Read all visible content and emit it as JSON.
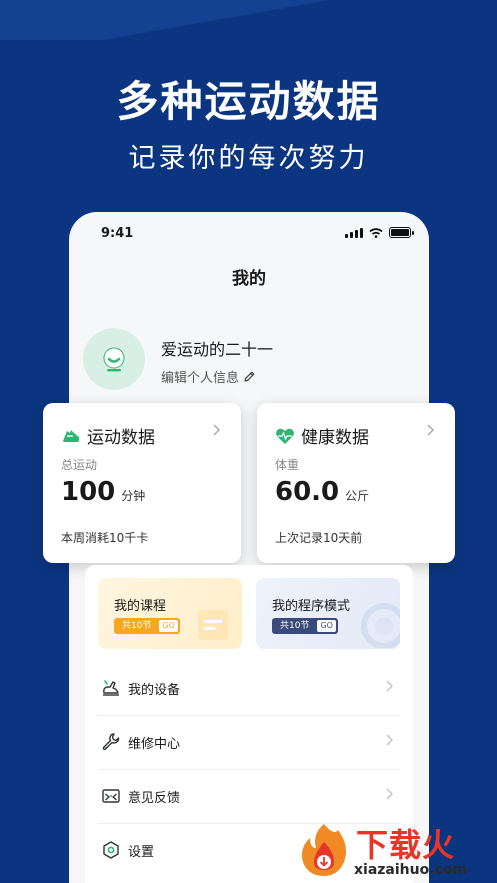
{
  "promo": {
    "headline": "多种运动数据",
    "subline": "记录你的每次努力"
  },
  "status_bar": {
    "time": "9:41"
  },
  "page": {
    "title": "我的"
  },
  "profile": {
    "nickname": "爱运动的二十一",
    "edit_label": "编辑个人信息"
  },
  "sport_card": {
    "title": "运动数据",
    "metric_label": "总运动",
    "value": "100",
    "unit": "分钟",
    "footer": "本周消耗10千卡",
    "icon": "shoe-icon",
    "accent": "#2bb673"
  },
  "health_card": {
    "title": "健康数据",
    "metric_label": "体重",
    "value": "60.0",
    "unit": "公斤",
    "footer": "上次记录10天前",
    "icon": "heart-pulse-icon",
    "accent": "#2bb673"
  },
  "courses": {
    "title": "我的课程",
    "count": "共10节",
    "go": "GO",
    "color": "#f5a623"
  },
  "program_mode": {
    "title": "我的程序模式",
    "count": "共10节",
    "go": "GO",
    "color": "#3a4a7a"
  },
  "menu": [
    {
      "label": "我的设备",
      "icon": "device-icon"
    },
    {
      "label": "维修中心",
      "icon": "wrench-icon"
    },
    {
      "label": "意见反馈",
      "icon": "feedback-icon"
    },
    {
      "label": "设置",
      "icon": "settings-icon"
    }
  ],
  "watermark": {
    "text": "下载火",
    "url": "xiazaihuo.com"
  }
}
